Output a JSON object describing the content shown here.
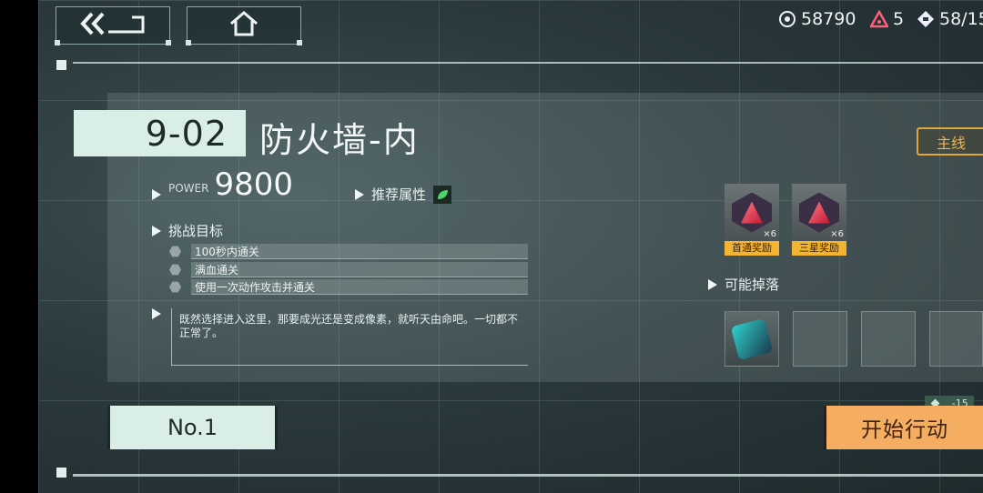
{
  "header": {
    "back_icon": "double-chevron-left-icon",
    "home_icon": "home-icon",
    "resources": [
      {
        "icon": "coin-icon",
        "value": "58790"
      },
      {
        "icon": "crystal-icon",
        "value": "5"
      },
      {
        "icon": "stamina-ticket-icon",
        "value": "58/15"
      }
    ]
  },
  "stage": {
    "code": "9-02",
    "name": "防火墙-内",
    "power_label": "POWER",
    "power_value": "9800",
    "recommended_attr_label": "推荐属性",
    "recommended_attr_icon": "leaf-icon",
    "category_tag": "主线"
  },
  "challenge": {
    "title": "挑战目标",
    "objectives": [
      "100秒内通关",
      "满血通关",
      "使用一次动作攻击并通关"
    ]
  },
  "description": "既然选择进入这里，那要成光还是变成像素，就听天由命吧。一切都不正常了。",
  "rewards": [
    {
      "label": "首通奖励",
      "count": "×6",
      "icon": "red-crystal-icon"
    },
    {
      "label": "三星奖励",
      "count": "×6",
      "icon": "red-crystal-icon"
    }
  ],
  "drops": {
    "title": "可能掉落",
    "items": [
      "device-icon"
    ]
  },
  "footer": {
    "rank_label": "No.1",
    "cost": "-15",
    "start_label": "开始行动"
  },
  "colors": {
    "accent_mint": "#d9eee7",
    "start_orange": "#f5ad62",
    "reward_gold": "#f3b531",
    "tag_orange": "#e0a640"
  }
}
